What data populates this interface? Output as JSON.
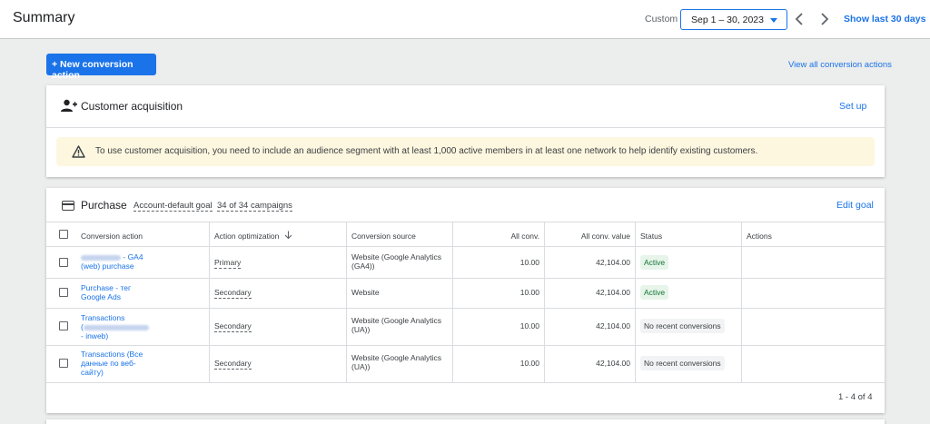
{
  "header": {
    "title": "Summary",
    "custom_label": "Custom",
    "date_range": "Sep 1 – 30, 2023",
    "show_last": "Show last 30 days"
  },
  "actions": {
    "new_conversion": "+ New conversion action",
    "view_all": "View all conversion actions"
  },
  "customer_acquisition": {
    "title": "Customer acquisition",
    "setup": "Set up",
    "warning": "To use customer acquisition, you need to include an audience segment with at least 1,000 active members in at least one network to help identify existing customers."
  },
  "purchase": {
    "title": "Purchase",
    "goal_type": "Account-default goal",
    "campaigns": "34 of 34 campaigns",
    "edit_goal": "Edit goal"
  },
  "table": {
    "headers": {
      "conversion_action": "Conversion action",
      "action_optimization": "Action optimization",
      "conversion_source": "Conversion source",
      "all_conv": "All conv.",
      "all_conv_value": "All conv. value",
      "status": "Status",
      "actions": "Actions"
    },
    "rows": [
      {
        "name_suffix": "- GA4",
        "name_line2": "(web) purchase",
        "optimization": "Primary",
        "source_line1": "Website (Google Analytics",
        "source_line2": "(GA4))",
        "all_conv": "10.00",
        "all_conv_value": "42,104.00",
        "status": "Active"
      },
      {
        "name_line1": "Purchase - тег",
        "name_line2": "Google Ads",
        "optimization": "Secondary",
        "source_line1": "Website",
        "all_conv": "10.00",
        "all_conv_value": "42,104.00",
        "status": "Active"
      },
      {
        "name_line1": "Transactions",
        "name_line2_prefix": "(",
        "name_line3": "- inweb)",
        "optimization": "Secondary",
        "source_line1": "Website (Google Analytics",
        "source_line2": "(UA))",
        "all_conv": "10.00",
        "all_conv_value": "42,104.00",
        "status": "No recent conversions"
      },
      {
        "name_line1": "Transactions (Все",
        "name_line2": "данные по веб-",
        "name_line3": "сайту)",
        "optimization": "Secondary",
        "source_line1": "Website (Google Analytics",
        "source_line2": "(UA))",
        "all_conv": "10.00",
        "all_conv_value": "42,104.00",
        "status": "No recent conversions"
      }
    ],
    "pagination": "1 - 4 of 4",
    "sort_icon": "arrow-down-icon"
  },
  "colors": {
    "accent": "#1a73e8",
    "active_bg": "#e6f4ea",
    "active_text": "#137333",
    "warning_bg": "#fef7e0",
    "warning_icon": "#3c4043"
  }
}
